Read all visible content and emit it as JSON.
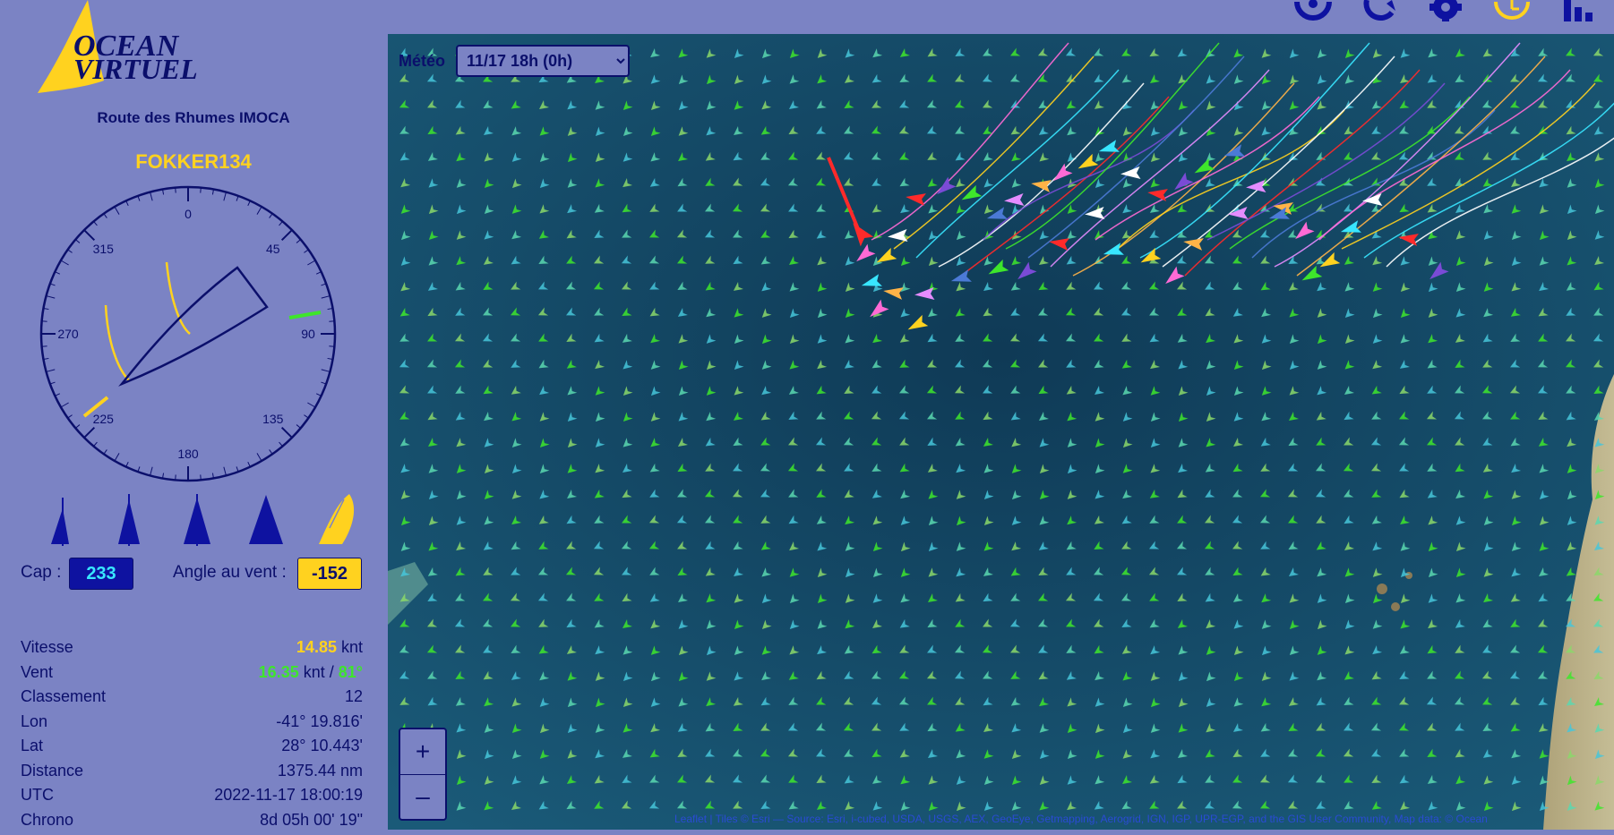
{
  "app": {
    "logo_text_line1": "OCEAN",
    "logo_text_line2": "VIRTUEL",
    "race_name": "Route des Rhumes IMOCA",
    "boat_name": "FOKKER134"
  },
  "compass": {
    "labels": [
      "0",
      "45",
      "90",
      "135",
      "180",
      "225",
      "270",
      "315"
    ],
    "heading_deg": 233,
    "wind_deg": 81
  },
  "sails": {
    "items": [
      "jib-sail",
      "genoa-sail",
      "staysail",
      "spinnaker-sail",
      "code-zero-sail"
    ],
    "selected_index": 4
  },
  "controls": {
    "cap_label": "Cap :",
    "cap_value": "233",
    "twa_label": "Angle au vent :",
    "twa_value": "-152"
  },
  "info": {
    "vitesse_label": "Vitesse",
    "vitesse_value": "14.85",
    "vitesse_unit": "knt",
    "vent_label": "Vent",
    "vent_speed": "16.35",
    "vent_unit": "knt /",
    "vent_dir": "81°",
    "classement_label": "Classement",
    "classement_value": "12",
    "lon_label": "Lon",
    "lon_value": "-41° 19.816'",
    "lat_label": "Lat",
    "lat_value": "28° 10.443'",
    "distance_label": "Distance",
    "distance_value": "1375.44 nm",
    "utc_label": "UTC",
    "utc_value": "2022-11-17 18:00:19",
    "chrono_label": "Chrono",
    "chrono_value": "8d 05h 00' 19\""
  },
  "toolbar": {
    "icons": [
      "target-icon",
      "refresh-icon",
      "gear-icon",
      "clock-icon",
      "ranking-icon"
    ]
  },
  "map": {
    "meteo_label": "Météo",
    "meteo_selected": "11/17 18h (0h)",
    "zoom_in": "+",
    "zoom_out": "–",
    "attribution": "Leaflet | Tiles © Esri — Source: Esri, i-cubed, USDA, USGS, AEX, GeoEye, Getmapping, Aerogrid, IGN, IGP, UPR-EGP, and the GIS User Community, Map data: © Ocean"
  },
  "colors": {
    "panel": "#7b83c4",
    "navy": "#0b0f6b",
    "accent_yellow": "#ffd21f",
    "accent_green": "#3ee62b",
    "accent_cyan": "#38e6ff"
  }
}
